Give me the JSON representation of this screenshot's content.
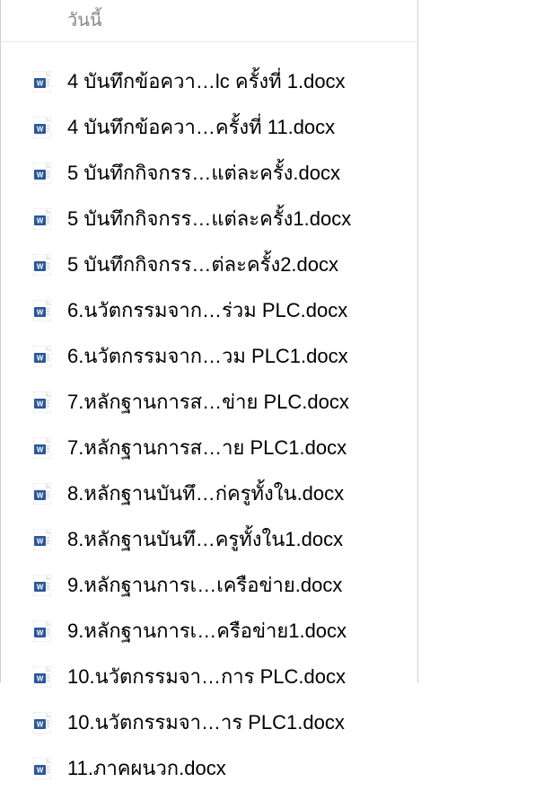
{
  "header": {
    "label": "วันนี้"
  },
  "files": [
    {
      "name": "4 บันทึกข้อควา…lc ครั้งที่ 1.docx",
      "type": "word"
    },
    {
      "name": "4 บันทึกข้อควา…ครั้งที่ 11.docx",
      "type": "word"
    },
    {
      "name": "5 บันทึกกิจกรร…แต่ละครั้ง.docx",
      "type": "word"
    },
    {
      "name": "5 บันทึกกิจกรร…แต่ละครั้ง1.docx",
      "type": "word"
    },
    {
      "name": "5 บันทึกกิจกรร…ต่ละครั้ง2.docx",
      "type": "word"
    },
    {
      "name": "6.นวัตกรรมจาก…ร่วม PLC.docx",
      "type": "word"
    },
    {
      "name": "6.นวัตกรรมจาก…วม PLC1.docx",
      "type": "word"
    },
    {
      "name": "7.หลักฐานการส…ข่าย PLC.docx",
      "type": "word"
    },
    {
      "name": "7.หลักฐานการส…าย PLC1.docx",
      "type": "word"
    },
    {
      "name": "8.หลักฐานบันทึ…ก่ครูทั้งใน.docx",
      "type": "word"
    },
    {
      "name": "8.หลักฐานบันทึ…ครูทั้งใน1.docx",
      "type": "word"
    },
    {
      "name": "9.หลักฐานการเ…เครือข่าย.docx",
      "type": "word"
    },
    {
      "name": "9.หลักฐานการเ…ครือข่าย1.docx",
      "type": "word"
    },
    {
      "name": "10.นวัตกรรมจา…การ PLC.docx",
      "type": "word"
    },
    {
      "name": "10.นวัตกรรมจา…าร PLC1.docx",
      "type": "word"
    },
    {
      "name": "11.ภาคผนวก.docx",
      "type": "word"
    }
  ]
}
